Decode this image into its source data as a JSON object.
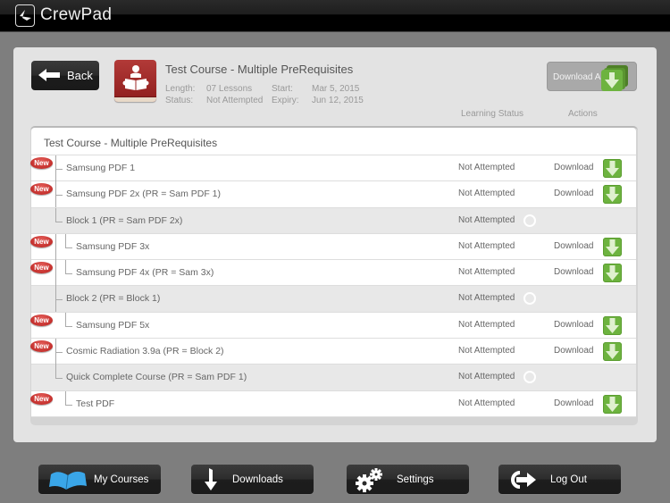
{
  "app": {
    "title": "CrewPad"
  },
  "course": {
    "title": "Test Course - Multiple PreRequisites",
    "length_label": "Length:",
    "length_value": "07 Lessons",
    "status_label": "Status:",
    "status_value": "Not Attempted",
    "start_label": "Start:",
    "start_value": "Mar 5, 2015",
    "expiry_label": "Expiry:",
    "expiry_value": "Jun 12, 2015"
  },
  "toolbar": {
    "back_label": "Back",
    "download_all_label": "Download All"
  },
  "columns": {
    "learning_status": "Learning Status",
    "actions": "Actions"
  },
  "list": {
    "header": "Test Course - Multiple PreRequisites",
    "badge_label": "New",
    "rows": [
      {
        "name": "Samsung PDF 1",
        "status": "Not Attempted",
        "action": "Download",
        "is_new": true,
        "type": "lesson"
      },
      {
        "name": "Samsung PDF 2x (PR = Sam PDF 1)",
        "status": "Not Attempted",
        "action": "Download",
        "is_new": true,
        "type": "lesson"
      },
      {
        "name": "Block 1 (PR = Sam PDF 2x)",
        "status": "Not Attempted",
        "action": "",
        "is_new": false,
        "type": "block"
      },
      {
        "name": "Samsung PDF 3x",
        "status": "Not Attempted",
        "action": "Download",
        "is_new": true,
        "type": "lesson"
      },
      {
        "name": "Samsung PDF 4x (PR = Sam 3x)",
        "status": "Not Attempted",
        "action": "Download",
        "is_new": true,
        "type": "lesson"
      },
      {
        "name": "Block 2 (PR = Block 1)",
        "status": "Not Attempted",
        "action": "",
        "is_new": false,
        "type": "block"
      },
      {
        "name": "Samsung PDF 5x",
        "status": "Not Attempted",
        "action": "Download",
        "is_new": true,
        "type": "lesson"
      },
      {
        "name": "Cosmic Radiation 3.9a (PR = Block 2)",
        "status": "Not Attempted",
        "action": "Download",
        "is_new": true,
        "type": "lesson"
      },
      {
        "name": "Quick Complete Course (PR = Sam PDF 1)",
        "status": "Not Attempted",
        "action": "",
        "is_new": false,
        "type": "block"
      },
      {
        "name": "Test PDF",
        "status": "Not Attempted",
        "action": "Download",
        "is_new": true,
        "type": "lesson"
      }
    ]
  },
  "nav": {
    "my_courses": "My Courses",
    "downloads": "Downloads",
    "settings": "Settings",
    "log_out": "Log Out"
  },
  "colors": {
    "accent_green": "#6db33f",
    "badge_red": "#c62d2a",
    "course_icon_red": "#a02a28",
    "my_courses_icon_blue": "#3aa6e8"
  }
}
